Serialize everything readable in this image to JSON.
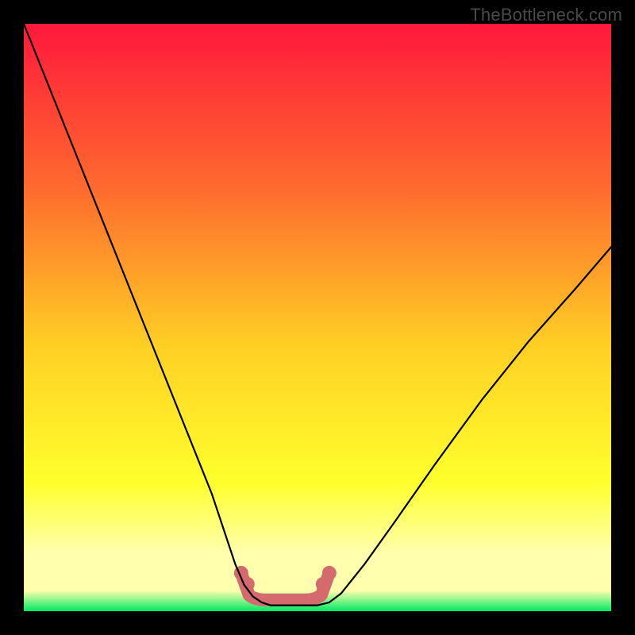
{
  "watermark": "TheBottleneck.com",
  "colors": {
    "frame": "#000000",
    "grad_top": "#ff183c",
    "grad_mid_upper": "#ff6a2e",
    "grad_mid": "#ffd024",
    "grad_mid_lower": "#ffff2c",
    "grad_pale": "#ffffad",
    "grad_green": "#00e863",
    "curve": "#000000",
    "bump_fill": "#d46a6e",
    "bump_stroke": "#c85b60"
  },
  "chart_data": {
    "type": "line",
    "title": "",
    "xlabel": "",
    "ylabel": "",
    "xlim": [
      0,
      100
    ],
    "ylim": [
      0,
      100
    ],
    "series": [
      {
        "name": "bottleneck-curve",
        "x": [
          0,
          4,
          8,
          12,
          16,
          20,
          24,
          28,
          32,
          34,
          36,
          37.5,
          39,
          40.5,
          42,
          44,
          46,
          48,
          50,
          52,
          54,
          58,
          63,
          70,
          78,
          86,
          94,
          100
        ],
        "values": [
          100,
          90,
          80,
          70,
          60,
          50,
          40,
          30,
          20,
          14,
          8,
          4.5,
          2.5,
          1.5,
          1,
          1,
          1,
          1,
          1,
          1.5,
          3,
          8,
          15,
          25,
          36,
          46,
          55,
          62
        ]
      }
    ],
    "sweet_spot": {
      "x_start": 37,
      "x_end": 52,
      "y": 3
    }
  }
}
